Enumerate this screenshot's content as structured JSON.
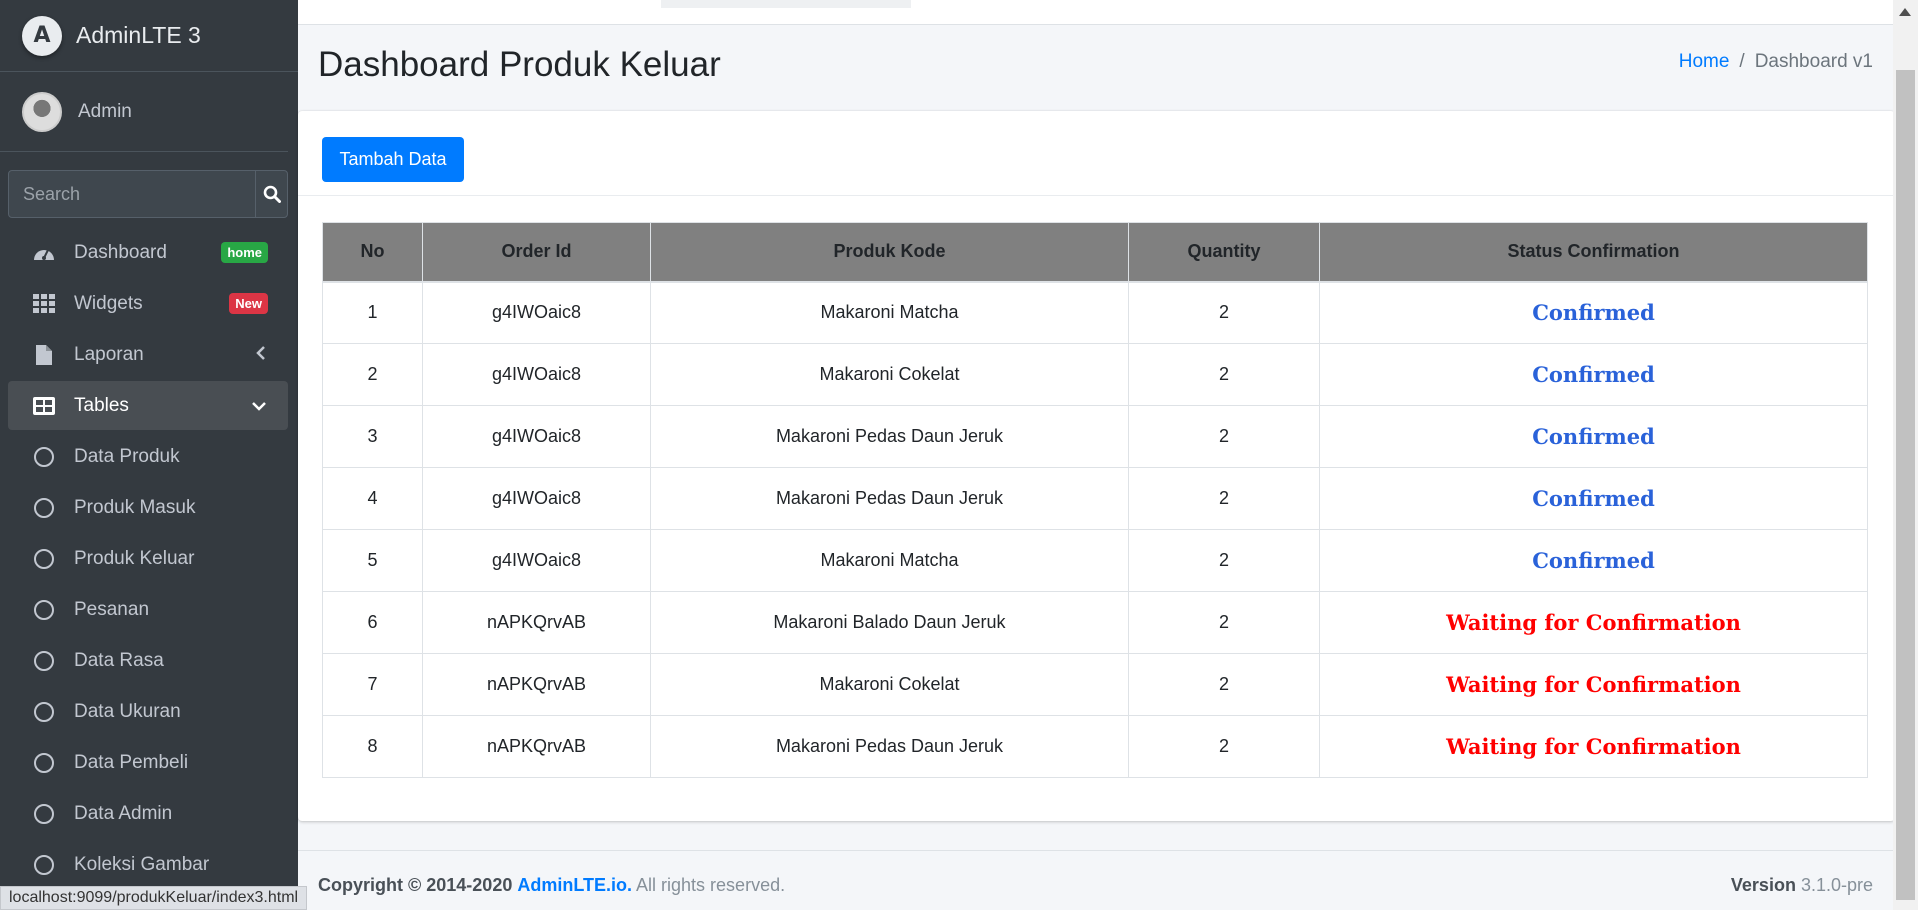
{
  "brand": {
    "name": "AdminLTE 3",
    "logo_letter": "A"
  },
  "user": {
    "name": "Admin"
  },
  "search": {
    "placeholder": "Search"
  },
  "sidebar": {
    "items": [
      {
        "label": "Dashboard",
        "icon": "tachometer-icon",
        "badge": "home",
        "badge_color": "#28a745"
      },
      {
        "label": "Widgets",
        "icon": "grid-icon",
        "badge": "New",
        "badge_color": "#dc3545"
      },
      {
        "label": "Laporan",
        "icon": "file-icon"
      },
      {
        "label": "Tables",
        "icon": "table-icon",
        "active": true
      },
      {
        "label": "Data Produk",
        "icon": "circle-icon"
      },
      {
        "label": "Produk Masuk",
        "icon": "circle-icon"
      },
      {
        "label": "Produk Keluar",
        "icon": "circle-icon"
      },
      {
        "label": "Pesanan",
        "icon": "circle-icon"
      },
      {
        "label": "Data Rasa",
        "icon": "circle-icon"
      },
      {
        "label": "Data Ukuran",
        "icon": "circle-icon"
      },
      {
        "label": "Data Pembeli",
        "icon": "circle-icon"
      },
      {
        "label": "Data Admin",
        "icon": "circle-icon"
      },
      {
        "label": "Koleksi Gambar",
        "icon": "circle-icon"
      }
    ]
  },
  "header": {
    "title": "Dashboard Produk Keluar",
    "breadcrumb_home": "Home",
    "breadcrumb_sep": "/",
    "breadcrumb_current": "Dashboard v1"
  },
  "card": {
    "add_button": "Tambah Data"
  },
  "table": {
    "columns": [
      "No",
      "Order Id",
      "Produk Kode",
      "Quantity",
      "Status Confirmation"
    ],
    "rows": [
      {
        "no": "1",
        "order_id": "g4IWOaic8",
        "produk": "Makaroni Matcha",
        "qty": "2",
        "status": "Confirmed"
      },
      {
        "no": "2",
        "order_id": "g4IWOaic8",
        "produk": "Makaroni Cokelat",
        "qty": "2",
        "status": "Confirmed"
      },
      {
        "no": "3",
        "order_id": "g4IWOaic8",
        "produk": "Makaroni Pedas Daun Jeruk",
        "qty": "2",
        "status": "Confirmed"
      },
      {
        "no": "4",
        "order_id": "g4IWOaic8",
        "produk": "Makaroni Pedas Daun Jeruk",
        "qty": "2",
        "status": "Confirmed"
      },
      {
        "no": "5",
        "order_id": "g4IWOaic8",
        "produk": "Makaroni Matcha",
        "qty": "2",
        "status": "Confirmed"
      },
      {
        "no": "6",
        "order_id": "nAPKQrvAB",
        "produk": "Makaroni Balado Daun Jeruk",
        "qty": "2",
        "status": "Waiting for Confirmation"
      },
      {
        "no": "7",
        "order_id": "nAPKQrvAB",
        "produk": "Makaroni Cokelat",
        "qty": "2",
        "status": "Waiting for Confirmation"
      },
      {
        "no": "8",
        "order_id": "nAPKQrvAB",
        "produk": "Makaroni Pedas Daun Jeruk",
        "qty": "2",
        "status": "Waiting for Confirmation"
      }
    ]
  },
  "footer": {
    "copyright": "Copyright © 2014-2020",
    "link": "AdminLTE.io.",
    "rights": "All rights reserved.",
    "version_label": "Version",
    "version": "3.1.0-pre"
  },
  "statusbar": {
    "url": "localhost:9099/produkKeluar/index3.html"
  },
  "colors": {
    "confirmed": "#2a62d9",
    "waiting": "#ff0000",
    "primary": "#007bff",
    "sidebar_bg": "#343a40"
  }
}
